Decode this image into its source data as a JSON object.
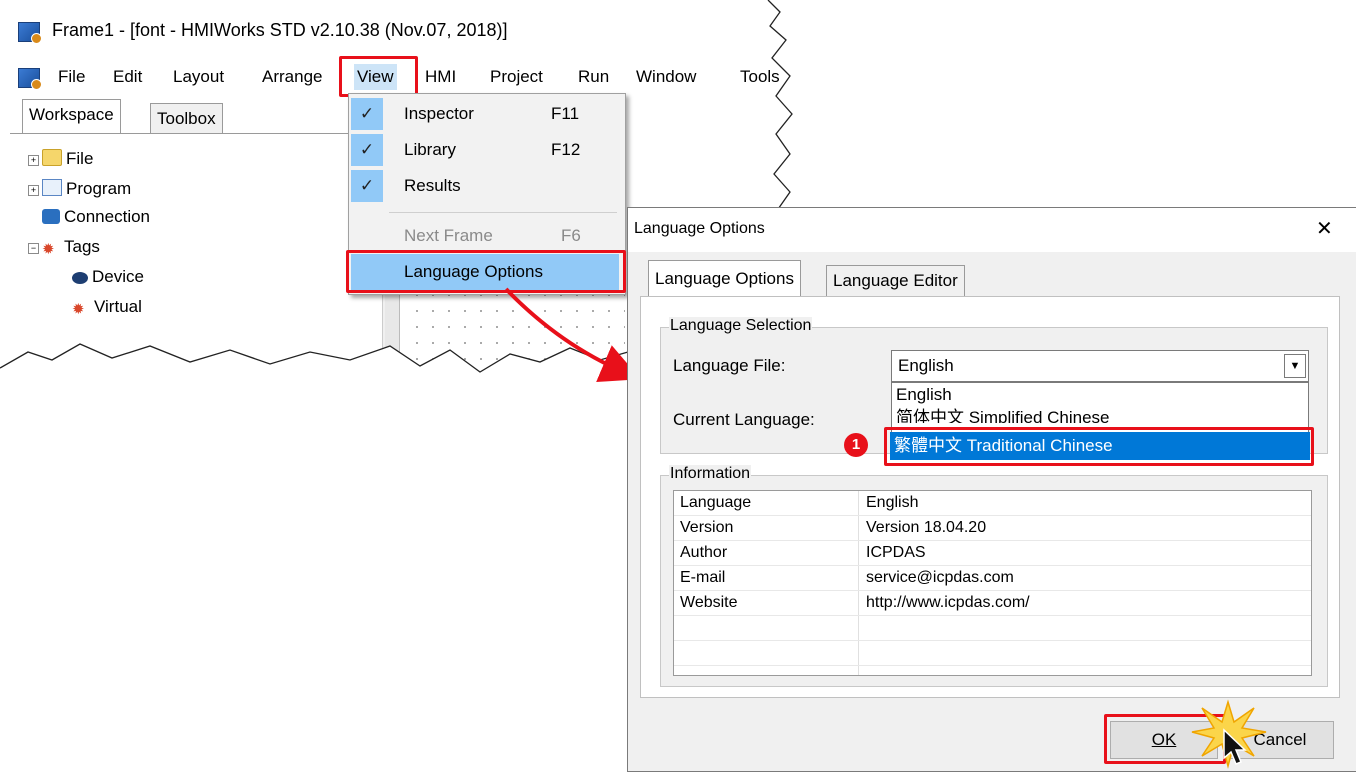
{
  "main_window": {
    "title": "Frame1 - [font - HMIWorks STD v2.10.38 (Nov.07, 2018)]",
    "menu": [
      "File",
      "Edit",
      "Layout",
      "Arrange",
      "View",
      "HMI",
      "Project",
      "Run",
      "Window",
      "Tools"
    ],
    "tabs": [
      "Workspace",
      "Toolbox"
    ],
    "tree": [
      {
        "label": "File",
        "icon": "folder-icon",
        "expander": "+"
      },
      {
        "label": "Program",
        "icon": "program-icon",
        "expander": "+"
      },
      {
        "label": "Connection",
        "icon": "connection-icon",
        "expander": ""
      },
      {
        "label": "Tags",
        "icon": "tags-icon",
        "expander": "−"
      },
      {
        "label": "Device",
        "icon": "device-icon",
        "expander": ""
      },
      {
        "label": "Virtual",
        "icon": "virtual-tag-icon",
        "expander": ""
      }
    ]
  },
  "view_menu": {
    "items": [
      {
        "label": "Inspector",
        "shortcut": "F11",
        "checked": true
      },
      {
        "label": "Library",
        "shortcut": "F12",
        "checked": true
      },
      {
        "label": "Results",
        "shortcut": "",
        "checked": true
      },
      {
        "label": "Next Frame",
        "shortcut": "F6",
        "disabled": true
      },
      {
        "label": "Language Options",
        "shortcut": "",
        "highlighted": true
      }
    ]
  },
  "dialog": {
    "title": "Language Options",
    "close_glyph": "✕",
    "tabs": [
      "Language Options",
      "Language Editor"
    ],
    "selection_group": "Language Selection",
    "language_file_label": "Language File:",
    "language_file_value": "English",
    "current_language_label": "Current Language:",
    "dropdown_options": [
      "English",
      "简体中文 Simplified Chinese",
      "繁體中文 Traditional Chinese"
    ],
    "selected_option_index": 2,
    "info_group": "Information",
    "info_rows": [
      {
        "key": "Language",
        "value": "English"
      },
      {
        "key": "Version",
        "value": "Version 18.04.20"
      },
      {
        "key": "Author",
        "value": "ICPDAS"
      },
      {
        "key": "E-mail",
        "value": "service@icpdas.com"
      },
      {
        "key": "Website",
        "value": "http://www.icpdas.com/"
      }
    ],
    "ok_label": "OK",
    "cancel_label": "Cancel",
    "step_badge": "1"
  },
  "colors": {
    "highlight_red": "#e8101a",
    "menu_highlight": "#91c9f7",
    "selection_blue": "#0078d7"
  }
}
